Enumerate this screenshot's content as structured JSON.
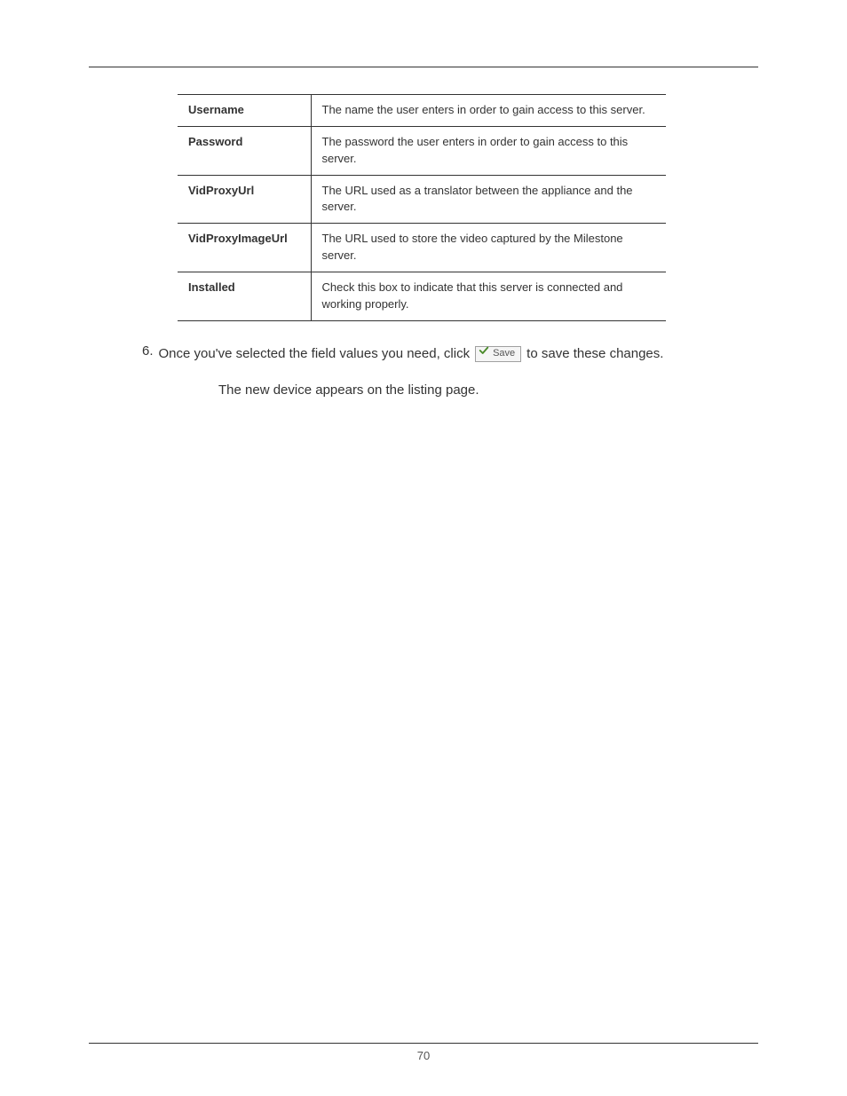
{
  "table": {
    "rows": [
      {
        "label": "Username",
        "description": "The name the user enters in order to gain access to this server."
      },
      {
        "label": "Password",
        "description": "The password the user enters in order to gain access to this server."
      },
      {
        "label": "VidProxyUrl",
        "description": "The URL used as a translator between the appliance and the server."
      },
      {
        "label": "VidProxyImageUrl",
        "description": "The URL used to store the video captured by the Milestone server."
      },
      {
        "label": "Installed",
        "description": "Check this box to indicate that this server is connected and working properly."
      }
    ]
  },
  "list": {
    "number": "6.",
    "text_before": "Once you've selected the field values you need, click",
    "save_label": "Save",
    "text_after": "to save these changes.",
    "secondary": "The new device appears on the listing page."
  },
  "footer": {
    "page_number": "70"
  }
}
